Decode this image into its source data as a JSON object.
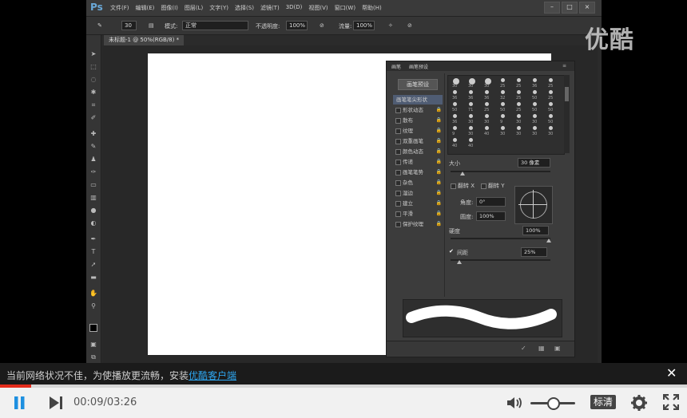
{
  "photoshop": {
    "logo": "Ps",
    "menus": [
      "文件(F)",
      "编辑(E)",
      "图像(I)",
      "图层(L)",
      "文字(Y)",
      "选择(S)",
      "滤镜(T)",
      "3D(D)",
      "视图(V)",
      "窗口(W)",
      "帮助(H)"
    ],
    "options": {
      "brush_size": "30",
      "mode_label": "模式:",
      "mode_value": "正常",
      "opacity_label": "不透明度:",
      "opacity_value": "100%",
      "flow_label": "流量:",
      "flow_value": "100%"
    },
    "document_tab": "未标题-1 @ 50%(RGB/8) *",
    "watermark": "优酷"
  },
  "brush_panel": {
    "tabs": [
      "画笔",
      "画笔预设"
    ],
    "preset_button": "画笔预设",
    "list": [
      {
        "label": "画笔笔尖形状",
        "active": true
      },
      {
        "label": "形状动态"
      },
      {
        "label": "散布"
      },
      {
        "label": "纹理"
      },
      {
        "label": "双重画笔"
      },
      {
        "label": "颜色动态"
      },
      {
        "label": "传递"
      },
      {
        "label": "画笔笔势"
      },
      {
        "label": "杂色"
      },
      {
        "label": "湿边"
      },
      {
        "label": "建立"
      },
      {
        "label": "平滑"
      },
      {
        "label": "保护纹理"
      }
    ],
    "size_label": "大小",
    "size_value": "30 像素",
    "flip_x": "翻转 X",
    "flip_y": "翻转 Y",
    "angle_label": "角度:",
    "angle_value": "0°",
    "roundness_label": "圆度:",
    "roundness_value": "100%",
    "hardness_label": "硬度",
    "hardness_value": "100%",
    "spacing_label": "间距",
    "spacing_value": "25%",
    "tip_sizes": [
      "30",
      "30",
      "30",
      "25",
      "25",
      "36",
      "25",
      "36",
      "36",
      "36",
      "32",
      "25",
      "50",
      "25",
      "50",
      "71",
      "25",
      "50",
      "25",
      "50",
      "50",
      "36",
      "30",
      "30",
      "9",
      "30",
      "30",
      "50",
      "9",
      "30",
      "40",
      "30",
      "30",
      "30",
      "30",
      "40",
      "40"
    ]
  },
  "player": {
    "notice_text": "当前网络状况不佳，为使播放更流畅，安装",
    "notice_link": "优酷客户端",
    "current_time": "00:09",
    "total_time": "03:26",
    "time_display": "00:09/03:26",
    "progress": 0.045,
    "quality": "标清",
    "volume": 0.5
  }
}
